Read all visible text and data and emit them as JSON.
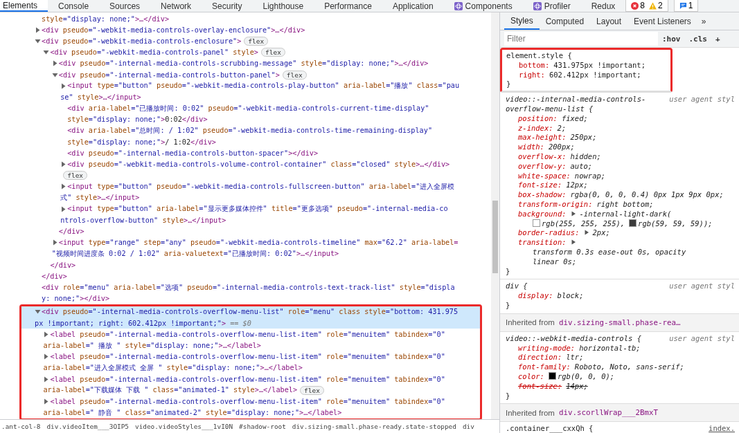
{
  "tabs": [
    {
      "label": "Elements",
      "selected": true,
      "kind": "builtin"
    },
    {
      "label": "Console",
      "selected": false,
      "kind": "builtin"
    },
    {
      "label": "Sources",
      "selected": false,
      "kind": "builtin"
    },
    {
      "label": "Network",
      "selected": false,
      "kind": "builtin"
    },
    {
      "label": "Security",
      "selected": false,
      "kind": "builtin"
    },
    {
      "label": "Lighthouse",
      "selected": false,
      "kind": "builtin"
    },
    {
      "label": "Performance",
      "selected": false,
      "kind": "builtin"
    },
    {
      "label": "Application",
      "selected": false,
      "kind": "builtin"
    },
    {
      "label": "Components",
      "selected": false,
      "kind": "plugin"
    },
    {
      "label": "Profiler",
      "selected": false,
      "kind": "plugin"
    },
    {
      "label": "Redux",
      "selected": false,
      "kind": "builtin"
    }
  ],
  "counters": [
    {
      "kind": "error",
      "count": "8"
    },
    {
      "kind": "warning",
      "count": "2"
    },
    {
      "kind": "message",
      "count": "1"
    }
  ],
  "tree": [
    {
      "kind": "fragment",
      "selected": false,
      "outlined": false,
      "lines": [
        [
          {
            "kind": "attr",
            "text": "style"
          },
          {
            "kind": "value",
            "text": "=\"display: none;\""
          },
          {
            "kind": "tag",
            "text": ">…</div>"
          }
        ]
      ]
    },
    {
      "kind": "parent",
      "expanded": false,
      "selected": false,
      "outlined": false,
      "lines": [
        [
          {
            "kind": "tag",
            "text": "<div"
          },
          {
            "kind": "attr",
            "text": " pseudo"
          },
          {
            "kind": "value",
            "text": "=\"-webkit-media-controls-overlay-enclosure\""
          },
          {
            "kind": "tag",
            "text": ">…</div>"
          }
        ]
      ]
    },
    {
      "kind": "parent",
      "expanded": true,
      "selected": false,
      "outlined": false,
      "lines": [
        [
          {
            "kind": "tag",
            "text": "<div"
          },
          {
            "kind": "attr",
            "text": " pseudo"
          },
          {
            "kind": "value",
            "text": "=\"-webkit-media-controls-enclosure\""
          },
          {
            "kind": "tag",
            "text": ">"
          },
          {
            "kind": "badge",
            "text": "flex"
          }
        ]
      ],
      "close": [
        {
          "kind": "tag",
          "text": "</div>"
        }
      ],
      "children": [
        {
          "kind": "parent",
          "expanded": true,
          "selected": false,
          "lines": [
            [
              {
                "kind": "tag",
                "text": "<div"
              },
              {
                "kind": "attr",
                "text": " pseudo"
              },
              {
                "kind": "value",
                "text": "=\"-webkit-media-controls-panel\""
              },
              {
                "kind": "attr",
                "text": " style"
              },
              {
                "kind": "tag",
                "text": ">"
              },
              {
                "kind": "badge",
                "text": "flex"
              }
            ]
          ],
          "close": [
            {
              "kind": "tag",
              "text": "</div>"
            }
          ],
          "children": [
            {
              "kind": "parent",
              "expanded": false,
              "selected": false,
              "lines": [
                [
                  {
                    "kind": "tag",
                    "text": "<div"
                  },
                  {
                    "kind": "attr",
                    "text": " pseudo"
                  },
                  {
                    "kind": "value",
                    "text": "=\"-internal-media-controls-scrubbing-message\""
                  },
                  {
                    "kind": "attr",
                    "text": " style"
                  },
                  {
                    "kind": "value",
                    "text": "=\"display: none;\""
                  },
                  {
                    "kind": "tag",
                    "text": ">…</div>"
                  }
                ]
              ]
            },
            {
              "kind": "parent",
              "expanded": true,
              "selected": false,
              "lines": [
                [
                  {
                    "kind": "tag",
                    "text": "<div"
                  },
                  {
                    "kind": "attr",
                    "text": " pseudo"
                  },
                  {
                    "kind": "value",
                    "text": "=\"-internal-media-controls-button-panel\""
                  },
                  {
                    "kind": "tag",
                    "text": ">"
                  },
                  {
                    "kind": "badge",
                    "text": "flex"
                  }
                ]
              ],
              "close": [
                {
                  "kind": "tag",
                  "text": "</div>"
                }
              ],
              "children": [
                {
                  "kind": "parent",
                  "expanded": false,
                  "selected": false,
                  "lines": [
                    [
                      {
                        "kind": "tag",
                        "text": "<input"
                      },
                      {
                        "kind": "attr",
                        "text": " type"
                      },
                      {
                        "kind": "value",
                        "text": "=\"button\""
                      },
                      {
                        "kind": "attr",
                        "text": " pseudo"
                      },
                      {
                        "kind": "value",
                        "text": "=\"-webkit-media-controls-play-button\""
                      },
                      {
                        "kind": "attr",
                        "text": " aria-label"
                      },
                      {
                        "kind": "value",
                        "text": "=\"播放\""
                      },
                      {
                        "kind": "attr",
                        "text": " class"
                      },
                      {
                        "kind": "value",
                        "text": "=\"pau"
                      }
                    ],
                    [
                      {
                        "kind": "value",
                        "text": "se\""
                      },
                      {
                        "kind": "attr",
                        "text": " style"
                      },
                      {
                        "kind": "tag",
                        "text": ">…</input>"
                      }
                    ]
                  ]
                },
                {
                  "kind": "leaf",
                  "selected": false,
                  "lines": [
                    [
                      {
                        "kind": "tag",
                        "text": "<div"
                      },
                      {
                        "kind": "attr",
                        "text": " aria-label"
                      },
                      {
                        "kind": "value",
                        "text": "=\"已播放时间: 0:02\""
                      },
                      {
                        "kind": "attr",
                        "text": " pseudo"
                      },
                      {
                        "kind": "value",
                        "text": "=\"-webkit-media-controls-current-time-display\""
                      }
                    ],
                    [
                      {
                        "kind": "attr",
                        "text": "style"
                      },
                      {
                        "kind": "value",
                        "text": "=\"display: none;\""
                      },
                      {
                        "kind": "tag",
                        "text": ">"
                      },
                      {
                        "kind": "text",
                        "text": "0:02"
                      },
                      {
                        "kind": "tag",
                        "text": "</div>"
                      }
                    ]
                  ]
                },
                {
                  "kind": "leaf",
                  "selected": false,
                  "lines": [
                    [
                      {
                        "kind": "tag",
                        "text": "<div"
                      },
                      {
                        "kind": "attr",
                        "text": " aria-label"
                      },
                      {
                        "kind": "value",
                        "text": "=\"总时间: / 1:02\""
                      },
                      {
                        "kind": "attr",
                        "text": " pseudo"
                      },
                      {
                        "kind": "value",
                        "text": "=\"-webkit-media-controls-time-remaining-display\""
                      }
                    ],
                    [
                      {
                        "kind": "attr",
                        "text": "style"
                      },
                      {
                        "kind": "value",
                        "text": "=\"display: none;\""
                      },
                      {
                        "kind": "tag",
                        "text": ">"
                      },
                      {
                        "kind": "text",
                        "text": "/ 1:02"
                      },
                      {
                        "kind": "tag",
                        "text": "</div>"
                      }
                    ]
                  ]
                },
                {
                  "kind": "leaf",
                  "selected": false,
                  "lines": [
                    [
                      {
                        "kind": "tag",
                        "text": "<div"
                      },
                      {
                        "kind": "attr",
                        "text": " pseudo"
                      },
                      {
                        "kind": "value",
                        "text": "=\"-internal-media-controls-button-spacer\""
                      },
                      {
                        "kind": "tag",
                        "text": "></div>"
                      }
                    ]
                  ]
                },
                {
                  "kind": "parent",
                  "expanded": false,
                  "selected": false,
                  "lines": [
                    [
                      {
                        "kind": "tag",
                        "text": "<div"
                      },
                      {
                        "kind": "attr",
                        "text": " pseudo"
                      },
                      {
                        "kind": "value",
                        "text": "=\"-webkit-media-controls-volume-control-container\""
                      },
                      {
                        "kind": "attr",
                        "text": " class"
                      },
                      {
                        "kind": "value",
                        "text": "=\"closed\""
                      },
                      {
                        "kind": "attr",
                        "text": " style"
                      },
                      {
                        "kind": "tag",
                        "text": ">…</div>"
                      }
                    ],
                    [
                      {
                        "kind": "badge",
                        "text": "flex"
                      }
                    ]
                  ]
                },
                {
                  "kind": "parent",
                  "expanded": false,
                  "selected": false,
                  "lines": [
                    [
                      {
                        "kind": "tag",
                        "text": "<input"
                      },
                      {
                        "kind": "attr",
                        "text": " type"
                      },
                      {
                        "kind": "value",
                        "text": "=\"button\""
                      },
                      {
                        "kind": "attr",
                        "text": " pseudo"
                      },
                      {
                        "kind": "value",
                        "text": "=\"-webkit-media-controls-fullscreen-button\""
                      },
                      {
                        "kind": "attr",
                        "text": " aria-label"
                      },
                      {
                        "kind": "value",
                        "text": "=\"进入全屏模"
                      }
                    ],
                    [
                      {
                        "kind": "value",
                        "text": "式\""
                      },
                      {
                        "kind": "attr",
                        "text": " style"
                      },
                      {
                        "kind": "tag",
                        "text": ">…</input>"
                      }
                    ]
                  ]
                },
                {
                  "kind": "parent",
                  "expanded": false,
                  "selected": false,
                  "lines": [
                    [
                      {
                        "kind": "tag",
                        "text": "<input"
                      },
                      {
                        "kind": "attr",
                        "text": " type"
                      },
                      {
                        "kind": "value",
                        "text": "=\"button\""
                      },
                      {
                        "kind": "attr",
                        "text": " aria-label"
                      },
                      {
                        "kind": "value",
                        "text": "=\"显示更多媒体控件\""
                      },
                      {
                        "kind": "attr",
                        "text": " title"
                      },
                      {
                        "kind": "value",
                        "text": "=\"更多选项\""
                      },
                      {
                        "kind": "attr",
                        "text": " pseudo"
                      },
                      {
                        "kind": "value",
                        "text": "=\"-internal-media-co"
                      }
                    ],
                    [
                      {
                        "kind": "value",
                        "text": "ntrols-overflow-button\""
                      },
                      {
                        "kind": "attr",
                        "text": " style"
                      },
                      {
                        "kind": "tag",
                        "text": ">…</input>"
                      }
                    ]
                  ]
                }
              ]
            },
            {
              "kind": "parent",
              "expanded": false,
              "selected": false,
              "lines": [
                [
                  {
                    "kind": "tag",
                    "text": "<input"
                  },
                  {
                    "kind": "attr",
                    "text": " type"
                  },
                  {
                    "kind": "value",
                    "text": "=\"range\""
                  },
                  {
                    "kind": "attr",
                    "text": " step"
                  },
                  {
                    "kind": "value",
                    "text": "=\"any\""
                  },
                  {
                    "kind": "attr",
                    "text": " pseudo"
                  },
                  {
                    "kind": "value",
                    "text": "=\"-webkit-media-controls-timeline\""
                  },
                  {
                    "kind": "attr",
                    "text": " max"
                  },
                  {
                    "kind": "value",
                    "text": "=\"62.2\""
                  },
                  {
                    "kind": "attr",
                    "text": " aria-label"
                  },
                  {
                    "kind": "tag",
                    "text": "="
                  }
                ],
                [
                  {
                    "kind": "value",
                    "text": "\"视频时间进度条 0:02 / 1:02\""
                  },
                  {
                    "kind": "attr",
                    "text": " aria-valuetext"
                  },
                  {
                    "kind": "value",
                    "text": "=\"已播放时间: 0:02\""
                  },
                  {
                    "kind": "tag",
                    "text": ">…</input>"
                  }
                ]
              ]
            }
          ]
        }
      ]
    },
    {
      "kind": "leaf",
      "selected": false,
      "outlined": false,
      "lines": [
        [
          {
            "kind": "tag",
            "text": "<div"
          },
          {
            "kind": "attr",
            "text": " role"
          },
          {
            "kind": "value",
            "text": "=\"menu\""
          },
          {
            "kind": "attr",
            "text": " aria-label"
          },
          {
            "kind": "value",
            "text": "=\"选项\""
          },
          {
            "kind": "attr",
            "text": " pseudo"
          },
          {
            "kind": "value",
            "text": "=\"-internal-media-controls-text-track-list\""
          },
          {
            "kind": "attr",
            "text": " style"
          },
          {
            "kind": "value",
            "text": "=\"displa"
          }
        ],
        [
          {
            "kind": "value",
            "text": "y: none;\""
          },
          {
            "kind": "tag",
            "text": "></div>"
          }
        ]
      ]
    },
    {
      "kind": "parent",
      "expanded": true,
      "selected": true,
      "outlined": true,
      "lines": [
        [
          {
            "kind": "tag",
            "text": "<div"
          },
          {
            "kind": "attr",
            "text": " pseudo"
          },
          {
            "kind": "value",
            "text": "=\"-internal-media-controls-overflow-menu-list\""
          },
          {
            "kind": "attr",
            "text": " role"
          },
          {
            "kind": "value",
            "text": "=\"menu\""
          },
          {
            "kind": "attr",
            "text": " class"
          },
          {
            "kind": "attr",
            "text": " style"
          },
          {
            "kind": "value",
            "text": "=\"bottom: 431.975"
          }
        ],
        [
          {
            "kind": "value",
            "text": "px !important; right: 602.412px !important;\""
          },
          {
            "kind": "tag",
            "text": ">"
          },
          {
            "kind": "dim",
            "text": " == $0"
          }
        ]
      ],
      "children": [
        {
          "kind": "parent",
          "expanded": false,
          "selected": false,
          "lines": [
            [
              {
                "kind": "tag",
                "text": "<label"
              },
              {
                "kind": "attr",
                "text": " pseudo"
              },
              {
                "kind": "value",
                "text": "=\"-internal-media-controls-overflow-menu-list-item\""
              },
              {
                "kind": "attr",
                "text": " role"
              },
              {
                "kind": "value",
                "text": "=\"menuitem\""
              },
              {
                "kind": "attr",
                "text": " tabindex"
              },
              {
                "kind": "value",
                "text": "=\"0\""
              }
            ],
            [
              {
                "kind": "attr",
                "text": "aria-label"
              },
              {
                "kind": "value",
                "text": "=\" 播放 \""
              },
              {
                "kind": "attr",
                "text": " style"
              },
              {
                "kind": "value",
                "text": "=\"display: none;\""
              },
              {
                "kind": "tag",
                "text": ">…</label>"
              }
            ]
          ]
        },
        {
          "kind": "parent",
          "expanded": false,
          "selected": false,
          "lines": [
            [
              {
                "kind": "tag",
                "text": "<label"
              },
              {
                "kind": "attr",
                "text": " pseudo"
              },
              {
                "kind": "value",
                "text": "=\"-internal-media-controls-overflow-menu-list-item\""
              },
              {
                "kind": "attr",
                "text": " role"
              },
              {
                "kind": "value",
                "text": "=\"menuitem\""
              },
              {
                "kind": "attr",
                "text": " tabindex"
              },
              {
                "kind": "value",
                "text": "=\"0\""
              }
            ],
            [
              {
                "kind": "attr",
                "text": "aria-label"
              },
              {
                "kind": "value",
                "text": "=\"进入全屏模式 全屏 \""
              },
              {
                "kind": "attr",
                "text": " style"
              },
              {
                "kind": "value",
                "text": "=\"display: none;\""
              },
              {
                "kind": "tag",
                "text": ">…</label>"
              }
            ]
          ]
        },
        {
          "kind": "parent",
          "expanded": false,
          "selected": false,
          "lines": [
            [
              {
                "kind": "tag",
                "text": "<label"
              },
              {
                "kind": "attr",
                "text": " pseudo"
              },
              {
                "kind": "value",
                "text": "=\"-internal-media-controls-overflow-menu-list-item\""
              },
              {
                "kind": "attr",
                "text": " role"
              },
              {
                "kind": "value",
                "text": "=\"menuitem\""
              },
              {
                "kind": "attr",
                "text": " tabindex"
              },
              {
                "kind": "value",
                "text": "=\"0\""
              }
            ],
            [
              {
                "kind": "attr",
                "text": "aria-label"
              },
              {
                "kind": "value",
                "text": "=\"下载媒体 下载 \""
              },
              {
                "kind": "attr",
                "text": " class"
              },
              {
                "kind": "value",
                "text": "=\"animated-1\""
              },
              {
                "kind": "attr",
                "text": " style"
              },
              {
                "kind": "tag",
                "text": ">…</label>"
              },
              {
                "kind": "badge",
                "text": "flex"
              }
            ]
          ]
        },
        {
          "kind": "parent",
          "expanded": false,
          "selected": false,
          "lines": [
            [
              {
                "kind": "tag",
                "text": "<label"
              },
              {
                "kind": "attr",
                "text": " pseudo"
              },
              {
                "kind": "value",
                "text": "=\"-internal-media-controls-overflow-menu-list-item\""
              },
              {
                "kind": "attr",
                "text": " role"
              },
              {
                "kind": "value",
                "text": "=\"menuitem\""
              },
              {
                "kind": "attr",
                "text": " tabindex"
              },
              {
                "kind": "value",
                "text": "=\"0\""
              }
            ],
            [
              {
                "kind": "attr",
                "text": "aria-label"
              },
              {
                "kind": "value",
                "text": "=\" 静音 \""
              },
              {
                "kind": "attr",
                "text": " class"
              },
              {
                "kind": "value",
                "text": "=\"animated-2\""
              },
              {
                "kind": "attr",
                "text": " style"
              },
              {
                "kind": "value",
                "text": "=\"display: none;\""
              },
              {
                "kind": "tag",
                "text": ">…</label>"
              }
            ]
          ]
        }
      ]
    }
  ],
  "breadcrumbs": [
    ".ant-col-8",
    "div.videoItem___3OIP5",
    "video.videoStyles___1vI0N",
    "#shadow-root",
    "div.sizing-small.phase-ready.state-stopped",
    "div"
  ],
  "styles_pane": {
    "tabs": [
      {
        "label": "Styles",
        "selected": true
      },
      {
        "label": "Computed",
        "selected": false
      },
      {
        "label": "Layout",
        "selected": false
      },
      {
        "label": "Event Listeners",
        "selected": false
      }
    ],
    "more": "»",
    "filter": {
      "placeholder": "Filter"
    },
    "filter_buttons": [
      ":hov",
      ".cls",
      "+"
    ],
    "sections": [
      {
        "kind": "rule",
        "outlined": true,
        "user_agent": false,
        "selector": "element.style {",
        "props": [
          {
            "name": "bottom:",
            "struck": false,
            "parts": [
              "431.975px !important;"
            ]
          },
          {
            "name": "right:",
            "struck": false,
            "parts": [
              "602.412px !important;"
            ]
          }
        ],
        "close": "}"
      },
      {
        "kind": "rule",
        "outlined": false,
        "user_agent": true,
        "selector": "video::-internal-media-controls-overflow-menu-list {",
        "origin": "user agent styl",
        "props": [
          {
            "name": "position:",
            "struck": false,
            "parts": [
              "fixed;"
            ]
          },
          {
            "name": "z-index:",
            "struck": false,
            "parts": [
              "2;"
            ]
          },
          {
            "name": "max-height:",
            "struck": false,
            "parts": [
              "250px;"
            ]
          },
          {
            "name": "width:",
            "struck": false,
            "parts": [
              "200px;"
            ]
          },
          {
            "name": "overflow-x:",
            "struck": false,
            "parts": [
              "hidden;"
            ]
          },
          {
            "name": "overflow-y:",
            "struck": false,
            "parts": [
              "auto;"
            ]
          },
          {
            "name": "white-space:",
            "struck": false,
            "parts": [
              "nowrap;"
            ]
          },
          {
            "name": "font-size:",
            "struck": false,
            "parts": [
              "12px;"
            ]
          },
          {
            "name": "box-shadow:",
            "struck": false,
            "parts": [
              "rgba(0, 0, 0, 0.4) 0px 1px 9px 0px;"
            ]
          },
          {
            "name": "transform-origin:",
            "struck": false,
            "parts": [
              "right bottom;"
            ]
          },
          {
            "name": "background:",
            "struck": false,
            "parts": [
              {
                "kind": "expander"
              },
              "-internal-light-dark(",
              {
                "kind": "swatch",
                "color": "#ffffff",
                "text": "rgb(255, 255, 255),"
              },
              {
                "kind": "swatch",
                "color": "#3b3b3b",
                "text": "rgb(59, 59, 59));"
              }
            ]
          },
          {
            "name": "border-radius:",
            "struck": false,
            "parts": [
              {
                "kind": "expander"
              },
              "2px;"
            ]
          },
          {
            "name": "transition:",
            "struck": false,
            "parts": [
              {
                "kind": "expander"
              },
              "transform 0.3s ease-out 0s, opacity",
              "linear 0s;"
            ]
          }
        ],
        "close": "}"
      },
      {
        "kind": "rule",
        "outlined": false,
        "user_agent": true,
        "selector": "div {",
        "origin": "user agent styl",
        "props": [
          {
            "name": "display:",
            "struck": false,
            "parts": [
              "block;"
            ]
          }
        ],
        "close": "}"
      },
      {
        "kind": "inherited",
        "label": "Inherited from",
        "source": "div.sizing-small.phase-rea…"
      },
      {
        "kind": "rule",
        "outlined": false,
        "user_agent": true,
        "selector": "video::-webkit-media-controls {",
        "origin": "user agent styl",
        "props": [
          {
            "name": "writing-mode:",
            "struck": false,
            "parts": [
              "horizontal-tb;"
            ]
          },
          {
            "name": "direction:",
            "struck": false,
            "parts": [
              "ltr;"
            ]
          },
          {
            "name": "font-family:",
            "struck": false,
            "parts": [
              "Roboto, Noto, sans-serif;"
            ]
          },
          {
            "name": "color:",
            "struck": false,
            "parts": [
              {
                "kind": "swatch",
                "color": "#000000",
                "text": "rgb(0, 0, 0);"
              }
            ]
          },
          {
            "name": "font-size:",
            "struck": true,
            "parts": [
              "14px;"
            ]
          }
        ],
        "close": "}"
      },
      {
        "kind": "inherited",
        "label": "Inherited from",
        "source": "div.scorllWrap___2BmxT"
      },
      {
        "kind": "rule",
        "outlined": false,
        "user_agent": false,
        "selector": ".container___cxxQh {",
        "origin": "index."
      }
    ]
  }
}
